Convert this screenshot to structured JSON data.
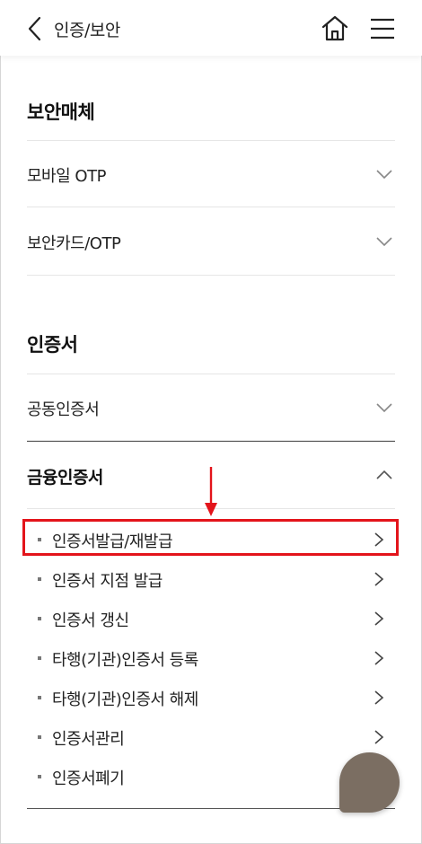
{
  "header": {
    "title": "인증/보안"
  },
  "security": {
    "title": "보안매체",
    "items": [
      {
        "label": "모바일 OTP"
      },
      {
        "label": "보안카드/OTP"
      }
    ]
  },
  "certificates": {
    "title": "인증서",
    "items": [
      {
        "label": "공동인증서"
      }
    ],
    "financial": {
      "label": "금융인증서",
      "subitems": [
        {
          "label": "인증서발급/재발급"
        },
        {
          "label": "인증서 지점 발급"
        },
        {
          "label": "인증서 갱신"
        },
        {
          "label": "타행(기관)인증서 등록"
        },
        {
          "label": "타행(기관)인증서 해제"
        },
        {
          "label": "인증서관리"
        },
        {
          "label": "인증서폐기"
        }
      ]
    }
  },
  "colors": {
    "highlight": "#e3141b",
    "fab": "#7b6e62"
  }
}
